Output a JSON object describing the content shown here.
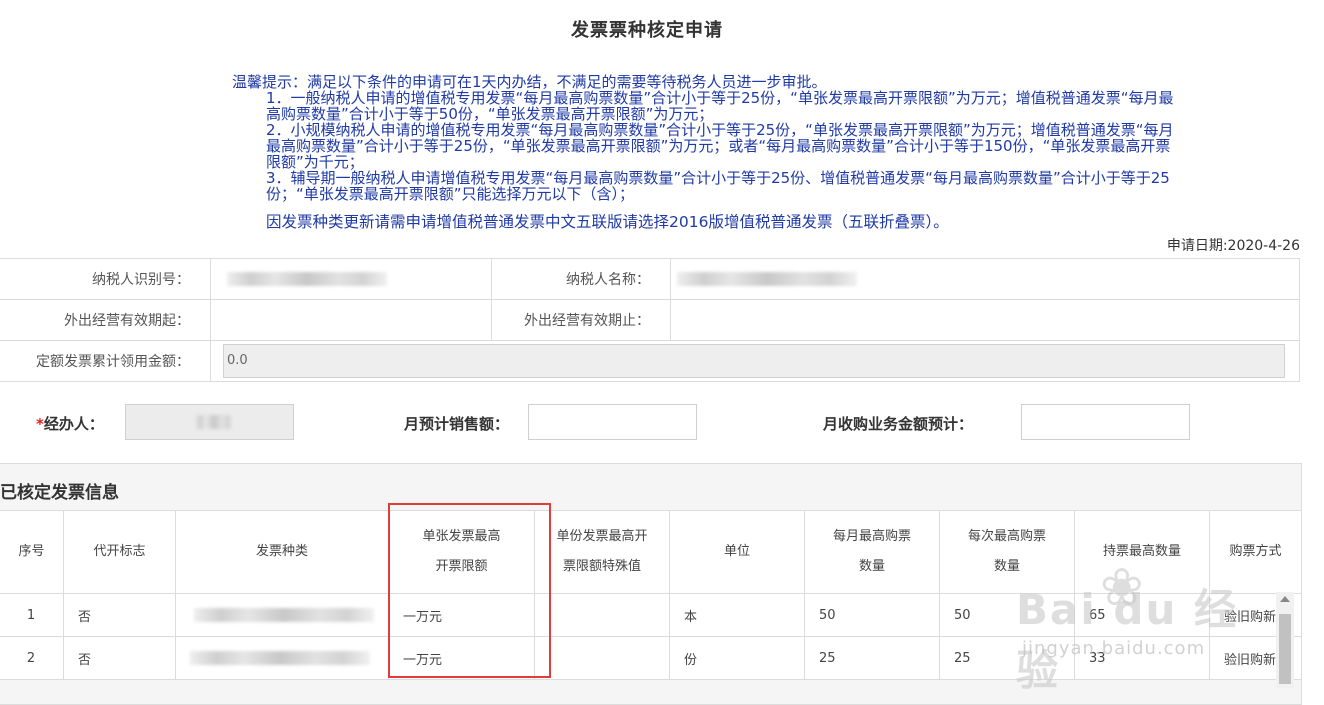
{
  "page": {
    "title": "发票票种核定申请"
  },
  "notice": {
    "line1": "温馨提示：满足以下条件的申请可在1天内办结，不满足的需要等待税务人员进一步审批。",
    "item1": "1．一般纳税人申请的增值税专用发票“每月最高购票数量”合计小于等于25份，“单张发票最高开票限额”为万元；增值税普通发票“每月最高购票数量”合计小于等于50份，“单张发票最高开票限额”为万元；",
    "item2": "2．小规模纳税人申请的增值税专用发票“每月最高购票数量”合计小于等于25份，“单张发票最高开票限额”为万元；增值税普通发票“每月最高购票数量”合计小于等于25份，“单张发票最高开票限额”为万元；或者“每月最高购票数量”合计小于等于150份，“单张发票最高开票限额”为千元；",
    "item3": "3．辅导期一般纳税人申请增值税专用发票“每月最高购票数量”合计小于等于25份、增值税普通发票“每月最高购票数量”合计小于等于25份；“单张发票最高开票限额”只能选择万元以下（含）；",
    "bottom": "因发票种类更新请需申请增值税普通发票中文五联版请选择2016版增值税普通发票（五联折叠票）。"
  },
  "apply_date": "申请日期:2020-4-26",
  "taxpayer": {
    "id_label": "纳税人识别号：",
    "name_label": "纳税人名称：",
    "valid_from_label": "外出经营有效期起：",
    "valid_to_label": "外出经营有效期止：",
    "amount_label": "定额发票累计领用金额：",
    "amount_value": "0.0"
  },
  "form": {
    "required_mark": "*",
    "handler_label": "经办人：",
    "monthly_sales_label": "月预计销售额：",
    "monthly_purchase_label": "月收购业务金额预计："
  },
  "section": {
    "title": "已核定发票信息"
  },
  "grid": {
    "headers": {
      "seq": "序号",
      "agent": "代开标志",
      "type": "发票种类",
      "max_single_1": "单张发票最高",
      "max_single_2": "开票限额",
      "special_1": "单份发票最高开",
      "special_2": "票限额特殊值",
      "unit": "单位",
      "monthly_1": "每月最高购票",
      "monthly_2": "数量",
      "each_1": "每次最高购票",
      "each_2": "数量",
      "hold": "持票最高数量",
      "method": "购票方式"
    },
    "rows": [
      {
        "seq": "1",
        "agent": "否",
        "limit": "一万元",
        "unit": "本",
        "monthly": "50",
        "each": "50",
        "hold": "65",
        "method": "验旧购新"
      },
      {
        "seq": "2",
        "agent": "否",
        "limit": "一万元",
        "unit": "份",
        "monthly": "25",
        "each": "25",
        "hold": "33",
        "method": "验旧购新"
      }
    ]
  },
  "watermark": {
    "brand": "Bai du 经验",
    "url": "jingyan.baidu.com"
  }
}
